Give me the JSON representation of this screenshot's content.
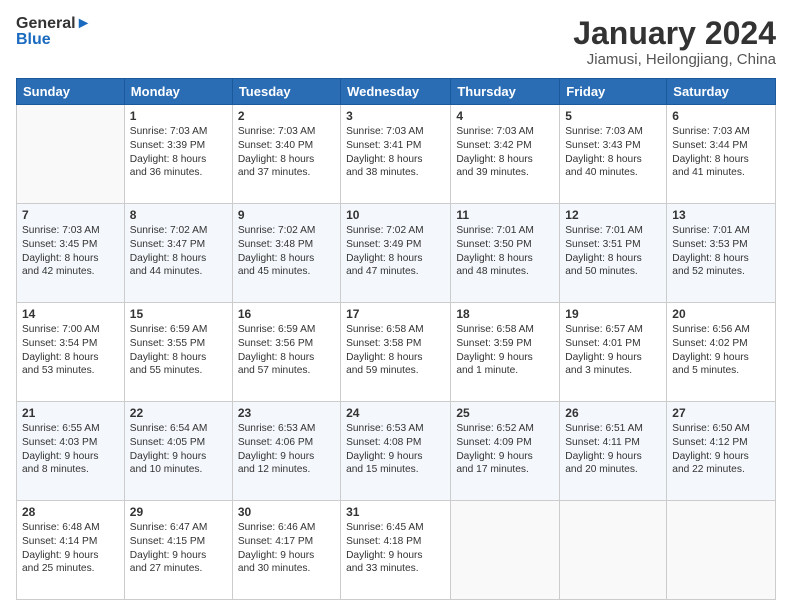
{
  "logo": {
    "line1": "General",
    "line2": "Blue"
  },
  "title": "January 2024",
  "location": "Jiamusi, Heilongjiang, China",
  "headers": [
    "Sunday",
    "Monday",
    "Tuesday",
    "Wednesday",
    "Thursday",
    "Friday",
    "Saturday"
  ],
  "weeks": [
    [
      {
        "day": "",
        "content": ""
      },
      {
        "day": "1",
        "content": "Sunrise: 7:03 AM\nSunset: 3:39 PM\nDaylight: 8 hours\nand 36 minutes."
      },
      {
        "day": "2",
        "content": "Sunrise: 7:03 AM\nSunset: 3:40 PM\nDaylight: 8 hours\nand 37 minutes."
      },
      {
        "day": "3",
        "content": "Sunrise: 7:03 AM\nSunset: 3:41 PM\nDaylight: 8 hours\nand 38 minutes."
      },
      {
        "day": "4",
        "content": "Sunrise: 7:03 AM\nSunset: 3:42 PM\nDaylight: 8 hours\nand 39 minutes."
      },
      {
        "day": "5",
        "content": "Sunrise: 7:03 AM\nSunset: 3:43 PM\nDaylight: 8 hours\nand 40 minutes."
      },
      {
        "day": "6",
        "content": "Sunrise: 7:03 AM\nSunset: 3:44 PM\nDaylight: 8 hours\nand 41 minutes."
      }
    ],
    [
      {
        "day": "7",
        "content": "Sunrise: 7:03 AM\nSunset: 3:45 PM\nDaylight: 8 hours\nand 42 minutes."
      },
      {
        "day": "8",
        "content": "Sunrise: 7:02 AM\nSunset: 3:47 PM\nDaylight: 8 hours\nand 44 minutes."
      },
      {
        "day": "9",
        "content": "Sunrise: 7:02 AM\nSunset: 3:48 PM\nDaylight: 8 hours\nand 45 minutes."
      },
      {
        "day": "10",
        "content": "Sunrise: 7:02 AM\nSunset: 3:49 PM\nDaylight: 8 hours\nand 47 minutes."
      },
      {
        "day": "11",
        "content": "Sunrise: 7:01 AM\nSunset: 3:50 PM\nDaylight: 8 hours\nand 48 minutes."
      },
      {
        "day": "12",
        "content": "Sunrise: 7:01 AM\nSunset: 3:51 PM\nDaylight: 8 hours\nand 50 minutes."
      },
      {
        "day": "13",
        "content": "Sunrise: 7:01 AM\nSunset: 3:53 PM\nDaylight: 8 hours\nand 52 minutes."
      }
    ],
    [
      {
        "day": "14",
        "content": "Sunrise: 7:00 AM\nSunset: 3:54 PM\nDaylight: 8 hours\nand 53 minutes."
      },
      {
        "day": "15",
        "content": "Sunrise: 6:59 AM\nSunset: 3:55 PM\nDaylight: 8 hours\nand 55 minutes."
      },
      {
        "day": "16",
        "content": "Sunrise: 6:59 AM\nSunset: 3:56 PM\nDaylight: 8 hours\nand 57 minutes."
      },
      {
        "day": "17",
        "content": "Sunrise: 6:58 AM\nSunset: 3:58 PM\nDaylight: 8 hours\nand 59 minutes."
      },
      {
        "day": "18",
        "content": "Sunrise: 6:58 AM\nSunset: 3:59 PM\nDaylight: 9 hours\nand 1 minute."
      },
      {
        "day": "19",
        "content": "Sunrise: 6:57 AM\nSunset: 4:01 PM\nDaylight: 9 hours\nand 3 minutes."
      },
      {
        "day": "20",
        "content": "Sunrise: 6:56 AM\nSunset: 4:02 PM\nDaylight: 9 hours\nand 5 minutes."
      }
    ],
    [
      {
        "day": "21",
        "content": "Sunrise: 6:55 AM\nSunset: 4:03 PM\nDaylight: 9 hours\nand 8 minutes."
      },
      {
        "day": "22",
        "content": "Sunrise: 6:54 AM\nSunset: 4:05 PM\nDaylight: 9 hours\nand 10 minutes."
      },
      {
        "day": "23",
        "content": "Sunrise: 6:53 AM\nSunset: 4:06 PM\nDaylight: 9 hours\nand 12 minutes."
      },
      {
        "day": "24",
        "content": "Sunrise: 6:53 AM\nSunset: 4:08 PM\nDaylight: 9 hours\nand 15 minutes."
      },
      {
        "day": "25",
        "content": "Sunrise: 6:52 AM\nSunset: 4:09 PM\nDaylight: 9 hours\nand 17 minutes."
      },
      {
        "day": "26",
        "content": "Sunrise: 6:51 AM\nSunset: 4:11 PM\nDaylight: 9 hours\nand 20 minutes."
      },
      {
        "day": "27",
        "content": "Sunrise: 6:50 AM\nSunset: 4:12 PM\nDaylight: 9 hours\nand 22 minutes."
      }
    ],
    [
      {
        "day": "28",
        "content": "Sunrise: 6:48 AM\nSunset: 4:14 PM\nDaylight: 9 hours\nand 25 minutes."
      },
      {
        "day": "29",
        "content": "Sunrise: 6:47 AM\nSunset: 4:15 PM\nDaylight: 9 hours\nand 27 minutes."
      },
      {
        "day": "30",
        "content": "Sunrise: 6:46 AM\nSunset: 4:17 PM\nDaylight: 9 hours\nand 30 minutes."
      },
      {
        "day": "31",
        "content": "Sunrise: 6:45 AM\nSunset: 4:18 PM\nDaylight: 9 hours\nand 33 minutes."
      },
      {
        "day": "",
        "content": ""
      },
      {
        "day": "",
        "content": ""
      },
      {
        "day": "",
        "content": ""
      }
    ]
  ]
}
